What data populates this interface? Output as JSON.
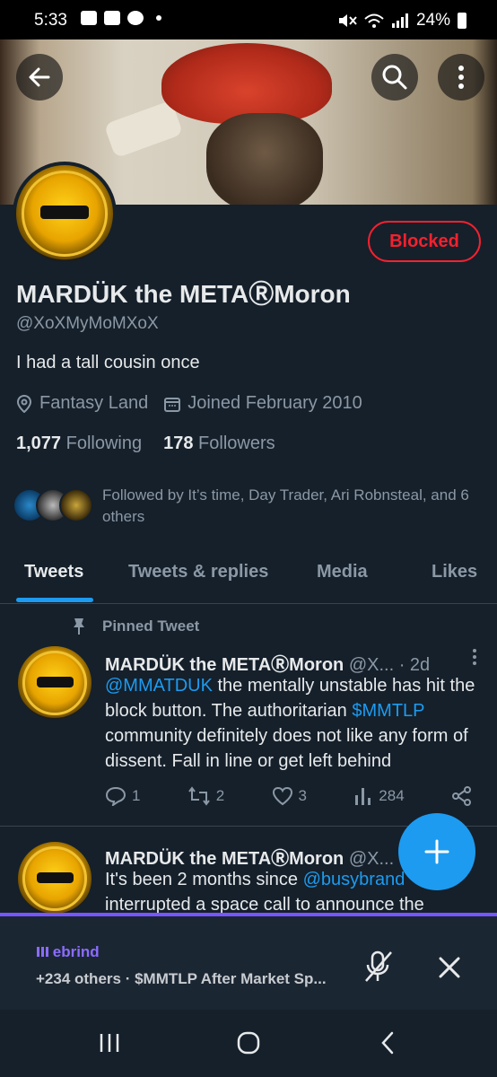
{
  "status_bar": {
    "time": "5:33",
    "battery": "24%"
  },
  "header": {
    "back_icon": "back-arrow-icon",
    "search_icon": "search-icon",
    "more_icon": "more-vertical-icon"
  },
  "profile": {
    "blocked_label": "Blocked",
    "name": "MARDÜK the METAⓇMoron",
    "handle": "@XoXMyMoMXoX",
    "bio": "I had a tall cousin once",
    "location": "Fantasy Land",
    "joined": "Joined February 2010",
    "following_count": "1,077",
    "following_label": "Following",
    "followers_count": "178",
    "followers_label": "Followers",
    "followed_by": "Followed by It’s time, Day Trader, Ari Robnsteal, and 6 others"
  },
  "tabs": [
    "Tweets",
    "Tweets & replies",
    "Media",
    "Likes"
  ],
  "pinned_label": "Pinned Tweet",
  "tweets": [
    {
      "name": "MARDÜK the METAⓇMoron",
      "handle": "@X...",
      "time": "· 2d",
      "body_mention": "@MMATDUK",
      "body_text_1": " the mentally unstable has hit the block button. The authoritarian ",
      "body_cashtag": "$MMTLP",
      "body_text_2": " community definitely does not like any form of dissent. Fall in line or get left behind",
      "replies": "1",
      "retweets": "2",
      "likes": "3",
      "views": "284"
    },
    {
      "name": "MARDÜK the METAⓇMoron",
      "handle": "@X...",
      "body_text_1": "It's been 2 months since ",
      "body_mention": "@busybrand",
      "body_text_2": " interrupted a space call to announce the"
    }
  ],
  "space": {
    "title": "ebrind",
    "subtitle": "+234 others · $MMTLP After Market Sp..."
  },
  "colors": {
    "accent": "#1d9bf0",
    "blocked": "#f4212e",
    "space_accent": "#7856ff",
    "background": "#15202b"
  }
}
